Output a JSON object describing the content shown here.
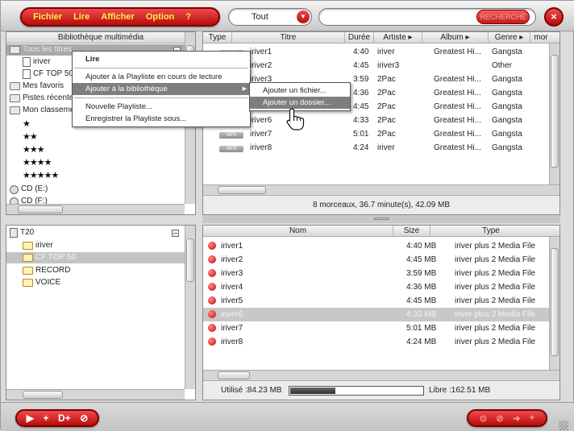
{
  "menu": {
    "items": [
      "Fichier",
      "Lire",
      "Afficher",
      "Option",
      "?"
    ],
    "filter_value": "Tout",
    "search_value": "",
    "search_button_label": "RECHERCHE"
  },
  "library": {
    "title": "Bibliothèque multimédia",
    "tree": [
      {
        "label": "Tous les titres",
        "selected": true
      },
      {
        "label": "iriver"
      },
      {
        "label": "CF TOP 50"
      },
      {
        "label": "Mes favoris"
      },
      {
        "label": "Pistes récentes"
      },
      {
        "label": "Mon classement"
      }
    ],
    "ratings": [
      "★",
      "★★",
      "★★★",
      "★★★★",
      "★★★★★"
    ],
    "drives": [
      "CD (E:)",
      "CD (F:)"
    ]
  },
  "playlist": {
    "columns": [
      "Type",
      "Titre",
      "Durée",
      "Artiste",
      "Album",
      "Genre",
      "mor"
    ],
    "rows": [
      {
        "type": "MP3",
        "title": "iriver1",
        "duration": "4:40",
        "artist": "iriver",
        "album": "",
        "genre": "Gangsta"
      },
      {
        "type": "MP3",
        "title": "iriver2",
        "duration": "4:45",
        "artist": "iriver3",
        "album": "",
        "genre": "Other"
      },
      {
        "type": "MP3",
        "title": "iriver3",
        "duration": "3:59",
        "artist": "2Pac",
        "album": "Greatest Hi...",
        "genre": "Gangsta"
      },
      {
        "type": "MP3",
        "title": "iriver4",
        "duration": "4:36",
        "artist": "2Pac",
        "album": "Greatest Hi...",
        "genre": "Gangsta"
      },
      {
        "type": "MP3",
        "title": "iriver5",
        "duration": "4:45",
        "artist": "2Pac",
        "album": "Greatest Hi...",
        "genre": "Gangsta"
      },
      {
        "type": "MP3",
        "title": "iriver6",
        "duration": "4:33",
        "artist": "2Pac",
        "album": "Greatest Hi...",
        "genre": "Gangsta"
      },
      {
        "type": "MP3",
        "title": "iriver7",
        "duration": "5:01",
        "artist": "2Pac",
        "album": "Greatest Hi...",
        "genre": "Gangsta"
      },
      {
        "type": "MP3",
        "title": "iriver8",
        "duration": "4:24",
        "artist": "iriver",
        "album": "Greatest Hi...",
        "genre": "Gangsta"
      }
    ],
    "first_album": "Greatest Hi...",
    "summary": "8 morceaux, 36.7 minute(s), 42.09 MB"
  },
  "context_menu": {
    "items": [
      "Lire",
      "Ajouter à la Playliste en cours de lecture",
      "Ajouter à la bibliothèque",
      "Nouvelle Playliste...",
      "Enregistrer la Playliste sous..."
    ],
    "submenu": [
      "Ajouter un fichier...",
      "Ajouter un dossier..."
    ]
  },
  "device": {
    "root": "T20",
    "folders": [
      {
        "label": "iriver"
      },
      {
        "label": "CF TOP 50",
        "selected": true
      },
      {
        "label": "RECORD"
      },
      {
        "label": "VOICE"
      }
    ]
  },
  "files": {
    "columns": [
      "Nom",
      "Size",
      "Type"
    ],
    "rows": [
      {
        "name": "iriver1",
        "size": "4:40 MB",
        "type": "iriver plus 2 Media File"
      },
      {
        "name": "iriver2",
        "size": "4:45 MB",
        "type": "iriver plus 2 Media File"
      },
      {
        "name": "iriver3",
        "size": "3:59 MB",
        "type": "iriver plus 2 Media File"
      },
      {
        "name": "iriver4",
        "size": "4:36 MB",
        "type": "iriver plus 2 Media File"
      },
      {
        "name": "iriver5",
        "size": "4:45 MB",
        "type": "iriver plus 2 Media File"
      },
      {
        "name": "iriver6",
        "size": "4:33 MB",
        "type": "iriver plus 2 Media File",
        "selected": true
      },
      {
        "name": "iriver7",
        "size": "5:01 MB",
        "type": "iriver plus 2 Media File"
      },
      {
        "name": "iriver8",
        "size": "4:24 MB",
        "type": "iriver plus 2 Media File"
      }
    ],
    "used": "Utilisé :84.23 MB",
    "free": "Libre :162.51 MB",
    "used_fraction": 0.34
  },
  "bottom": {
    "left_buttons": [
      "▶",
      "+",
      "D+",
      "⊘"
    ],
    "right_buttons": [
      "⊙",
      "⊘",
      "➜",
      "+"
    ]
  },
  "colors": {
    "accent_red": "#d01a1a",
    "menu_text": "#ffef4a",
    "selection_grey": "#d0d0d0",
    "highlight": "#7e7e7e"
  }
}
